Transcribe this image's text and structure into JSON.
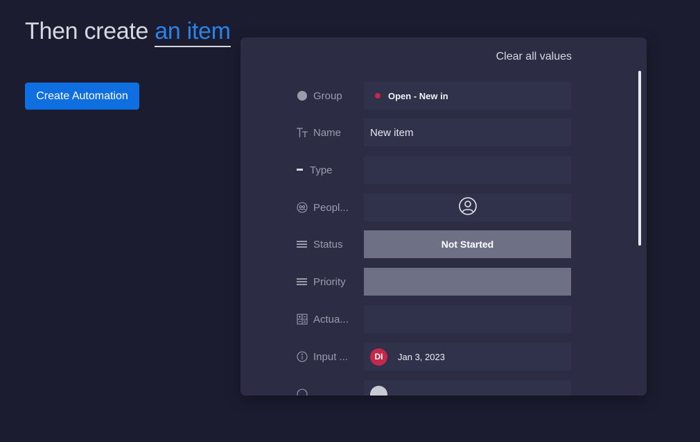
{
  "header": {
    "prefix": "Then create",
    "link": "an item",
    "button_label": "Create Automation"
  },
  "panel": {
    "clear_label": "Clear all values",
    "rows": [
      {
        "label": "Group",
        "icon": "circle-icon",
        "value": "Open - New in",
        "dot_color": "#c4284a"
      },
      {
        "label": "Name",
        "icon": "text-icon",
        "value": "New item"
      },
      {
        "label": "Type",
        "icon": "dash-icon",
        "value": ""
      },
      {
        "label": "Peopl...",
        "icon": "people-icon",
        "value": ""
      },
      {
        "label": "Status",
        "icon": "lines-icon",
        "value": "Not Started"
      },
      {
        "label": "Priority",
        "icon": "lines-icon",
        "value": ""
      },
      {
        "label": "Actua...",
        "icon": "numbers-icon",
        "value": ""
      },
      {
        "label": "Input ...",
        "icon": "info-icon",
        "avatar": "DI",
        "value": "Jan 3, 2023"
      }
    ]
  },
  "colors": {
    "background": "#1b1c30",
    "panel": "#2c2d45",
    "field": "#30314a",
    "status_grey": "#6e7086",
    "accent": "#0f6ee0",
    "link": "#2a83e8",
    "group_dot": "#c4284a"
  }
}
